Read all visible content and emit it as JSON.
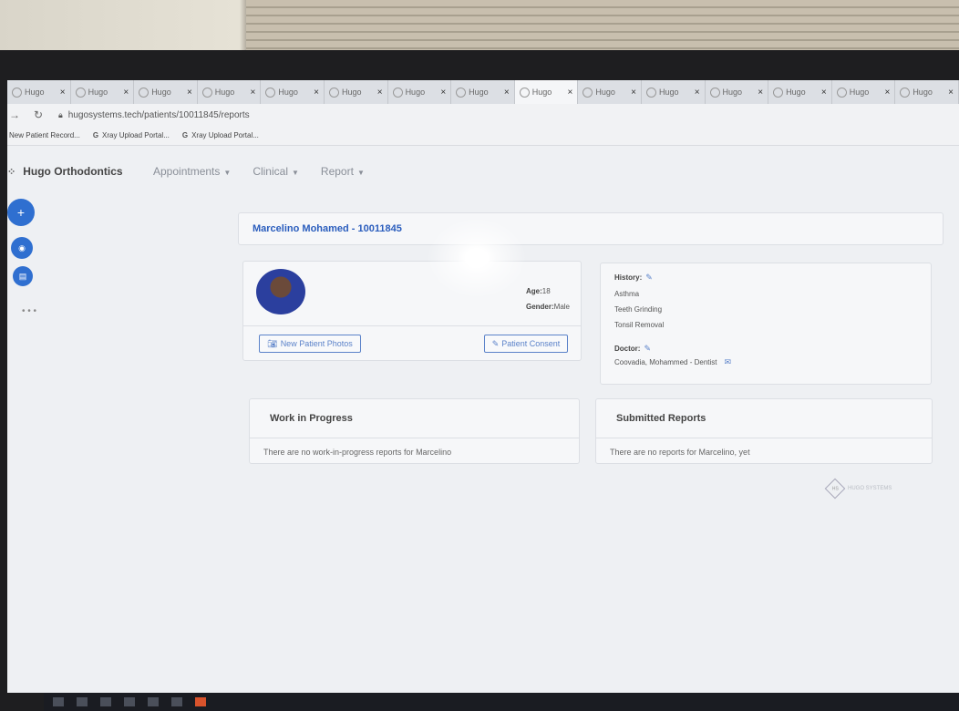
{
  "browser": {
    "tabs": [
      {
        "label": "Hugo"
      },
      {
        "label": "Hugo"
      },
      {
        "label": "Hugo"
      },
      {
        "label": "Hugo"
      },
      {
        "label": "Hugo"
      },
      {
        "label": "Hugo"
      },
      {
        "label": "Hugo"
      },
      {
        "label": "Hugo"
      },
      {
        "label": "Hugo"
      },
      {
        "label": "Hugo"
      },
      {
        "label": "Hugo"
      },
      {
        "label": "Hugo"
      },
      {
        "label": "Hugo"
      },
      {
        "label": "Hugo"
      },
      {
        "label": "Hugo"
      }
    ],
    "close_glyph": "×",
    "url": "hugosystems.tech/patients/10011845/reports",
    "bookmarks": [
      {
        "label": "New Patient Record..."
      },
      {
        "label": "Xray Upload Portal..."
      },
      {
        "label": "Xray Upload Portal..."
      }
    ]
  },
  "app": {
    "brand": "Hugo Orthodontics",
    "menu": [
      "Appointments",
      "Clinical",
      "Report"
    ],
    "patient_title": "Marcelino Mohamed - 10011845",
    "patient": {
      "age_label": "Age:",
      "age": "18",
      "gender_label": "Gender:",
      "gender": "Male"
    },
    "buttons": {
      "photos": "New Patient Photos",
      "consent": "Patient Consent"
    },
    "history": {
      "label": "History:",
      "items": [
        "Asthma",
        "Teeth Grinding",
        "Tonsil Removal"
      ],
      "doctor_label": "Doctor:",
      "doctor": "Coovadia, Mohammed - Dentist"
    },
    "work_in_progress": {
      "title": "Work in Progress",
      "empty": "There are no work-in-progress reports for Marcelino"
    },
    "submitted_reports": {
      "title": "Submitted Reports",
      "empty": "There are no reports for Marcelino, yet"
    },
    "footer_logo": "HUGO SYSTEMS"
  }
}
